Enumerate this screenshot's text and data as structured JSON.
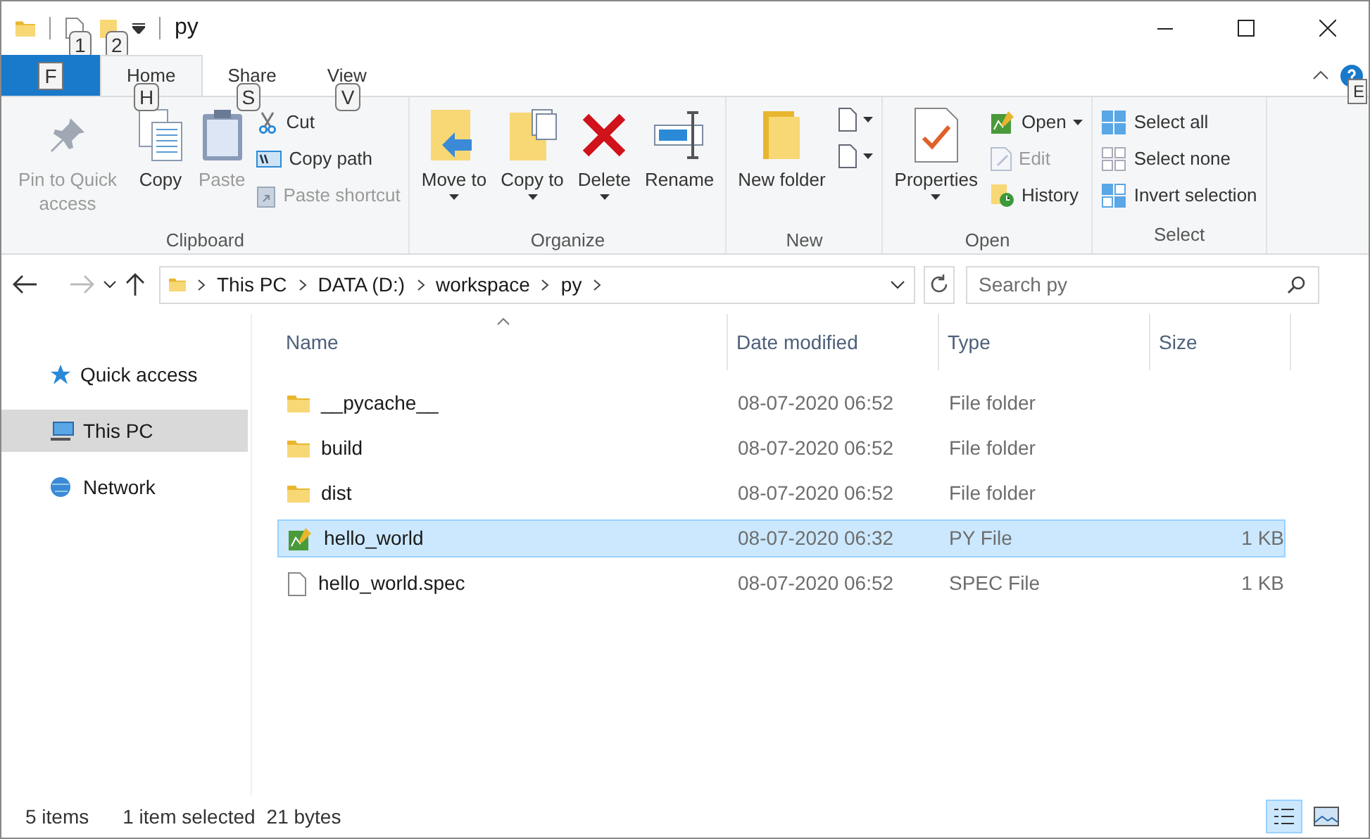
{
  "window": {
    "title": "py",
    "quick_access_keytips": [
      "1",
      "2"
    ]
  },
  "tabs": [
    {
      "label": "F",
      "kind": "file",
      "selected": false
    },
    {
      "label": "Home",
      "keytip": "H",
      "kind": "tab",
      "selected": true
    },
    {
      "label": "Share",
      "keytip": "S",
      "kind": "tab",
      "selected": false
    },
    {
      "label": "View",
      "keytip": "V",
      "kind": "tab",
      "selected": false
    }
  ],
  "help_keytip": "E",
  "ribbon": [
    {
      "name": "Clipboard",
      "items": [
        {
          "label": "Pin to Quick access",
          "kind": "large",
          "disabled": true
        },
        {
          "label": "Copy",
          "kind": "large",
          "disabled": false
        },
        {
          "label": "Paste",
          "kind": "large",
          "disabled": true
        },
        {
          "kind": "stack",
          "items": [
            {
              "label": "Cut",
              "disabled": false
            },
            {
              "label": "Copy path",
              "disabled": false
            },
            {
              "label": "Paste shortcut",
              "disabled": true
            }
          ]
        }
      ]
    },
    {
      "name": "Organize",
      "items": [
        {
          "label": "Move to",
          "kind": "large",
          "dropdown": true,
          "disabled": false
        },
        {
          "label": "Copy to",
          "kind": "large",
          "dropdown": true,
          "disabled": false
        },
        {
          "label": "Delete",
          "kind": "large",
          "dropdown": true,
          "disabled": false
        },
        {
          "label": "Rename",
          "kind": "large",
          "dropdown": false,
          "disabled": false
        }
      ]
    },
    {
      "name": "New",
      "items": [
        {
          "label": "New folder",
          "kind": "large",
          "disabled": false
        },
        {
          "kind": "iconstack",
          "items": [
            {
              "dropdown": true
            },
            {
              "dropdown": true
            }
          ]
        }
      ]
    },
    {
      "name": "Open",
      "items": [
        {
          "label": "Properties",
          "kind": "large",
          "dropdown": true,
          "disabled": false
        },
        {
          "kind": "stack",
          "items": [
            {
              "label": "Open",
              "dropdown": true,
              "disabled": false
            },
            {
              "label": "Edit",
              "disabled": true
            },
            {
              "label": "History",
              "disabled": false
            }
          ]
        }
      ]
    },
    {
      "name": "Select",
      "items": [
        {
          "kind": "stack",
          "items": [
            {
              "label": "Select all",
              "disabled": false
            },
            {
              "label": "Select none",
              "disabled": false
            },
            {
              "label": "Invert selection",
              "disabled": false
            }
          ]
        }
      ]
    }
  ],
  "address": {
    "path": [
      "This PC",
      "DATA (D:)",
      "workspace",
      "py"
    ]
  },
  "search": {
    "placeholder": "Search py"
  },
  "sidebar": {
    "items": [
      {
        "label": "Quick access",
        "selected": false
      },
      {
        "label": "This PC",
        "selected": true
      },
      {
        "label": "Network",
        "selected": false
      }
    ]
  },
  "table": {
    "columns": [
      "Name",
      "Date modified",
      "Type",
      "Size"
    ],
    "rows": [
      {
        "kind": "folder",
        "name": "__pycache__",
        "date": "08-07-2020 06:52",
        "type": "File folder",
        "selected": false
      },
      {
        "kind": "folder",
        "name": "build",
        "date": "08-07-2020 06:52",
        "type": "File folder",
        "selected": false
      },
      {
        "kind": "folder",
        "name": "dist",
        "date": "08-07-2020 06:52",
        "type": "File folder",
        "selected": false
      },
      {
        "kind": "py",
        "name": "hello_world",
        "date": "08-07-2020 06:32",
        "type": "PY File",
        "size": "1 KB",
        "selected": true
      },
      {
        "kind": "file",
        "name": "hello_world.spec",
        "date": "08-07-2020 06:52",
        "type": "SPEC File",
        "size": "1 KB",
        "selected": false
      }
    ]
  },
  "status_bar": {
    "count": "5 items",
    "selection": "1 item selected",
    "bytes": "21 bytes"
  }
}
